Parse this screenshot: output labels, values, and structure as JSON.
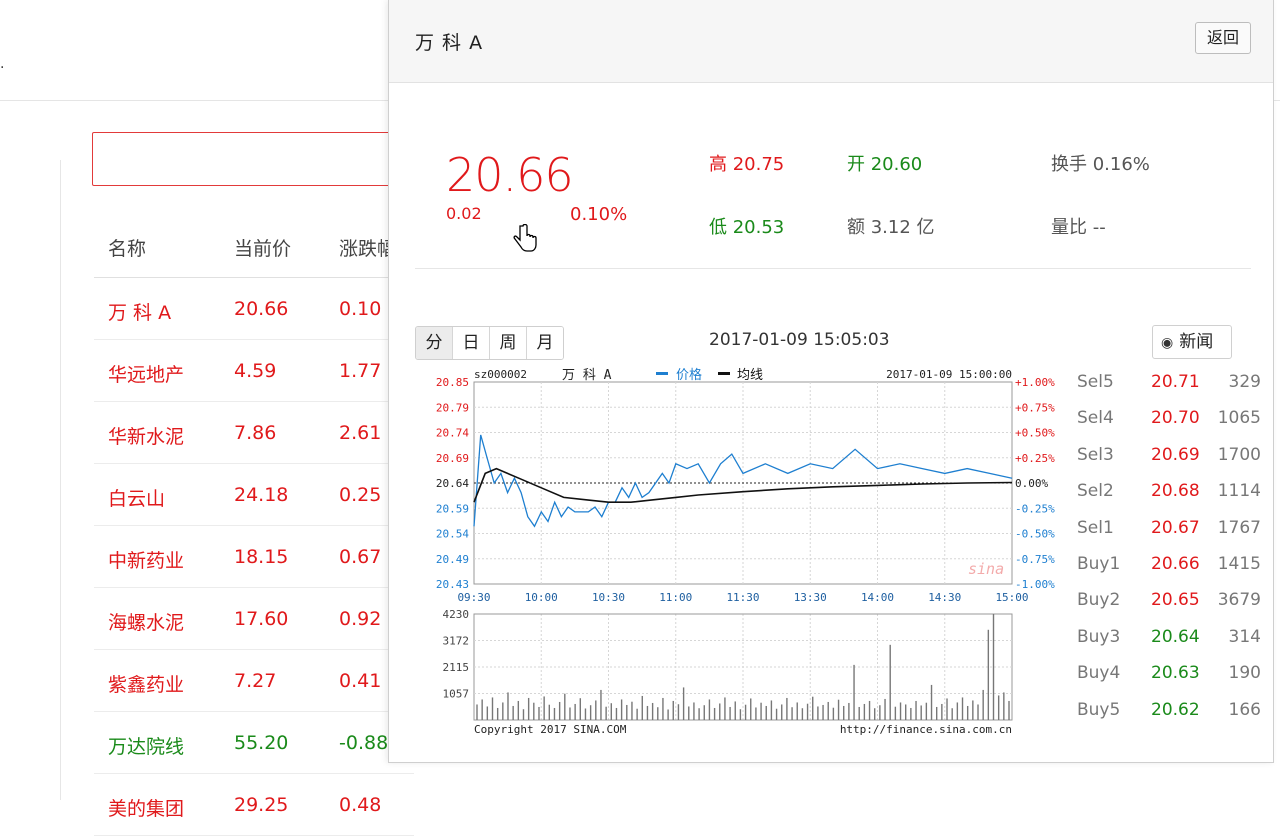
{
  "background": {
    "table_headers": [
      "名称",
      "当前价",
      "涨跌幅"
    ],
    "rows": [
      {
        "name": "万 科 A",
        "price": "20.66",
        "change": "0.10",
        "trend": "up"
      },
      {
        "name": "华远地产",
        "price": "4.59",
        "change": "1.77",
        "trend": "up"
      },
      {
        "name": "华新水泥",
        "price": "7.86",
        "change": "2.61",
        "trend": "up"
      },
      {
        "name": "白云山",
        "price": "24.18",
        "change": "0.25",
        "trend": "up"
      },
      {
        "name": "中新药业",
        "price": "18.15",
        "change": "0.67",
        "trend": "up"
      },
      {
        "name": "海螺水泥",
        "price": "17.60",
        "change": "0.92",
        "trend": "up"
      },
      {
        "name": "紫鑫药业",
        "price": "7.27",
        "change": "0.41",
        "trend": "up"
      },
      {
        "name": "万达院线",
        "price": "55.20",
        "change": "-0.88",
        "trend": "down"
      },
      {
        "name": "美的集团",
        "price": "29.25",
        "change": "0.48",
        "trend": "up"
      }
    ]
  },
  "panel": {
    "title": "万 科 A",
    "back_label": "返回",
    "price": "20.66",
    "change": "0.02",
    "change_pct": "0.10%",
    "high": "高 20.75",
    "low": "低 20.53",
    "open": "开 20.60",
    "amount": "额 3.12 亿",
    "turnover": "换手 0.16%",
    "volume_ratio": "量比 --",
    "tabs": [
      "分",
      "日",
      "周",
      "月"
    ],
    "active_tab": 0,
    "chart_time": "2017-01-09 15:05:03",
    "news_label": "新闻"
  },
  "order_book": [
    {
      "label": "Sel5",
      "price": "20.71",
      "volume": "329",
      "color": "#e0191b"
    },
    {
      "label": "Sel4",
      "price": "20.70",
      "volume": "1065",
      "color": "#e0191b"
    },
    {
      "label": "Sel3",
      "price": "20.69",
      "volume": "1700",
      "color": "#e0191b"
    },
    {
      "label": "Sel2",
      "price": "20.68",
      "volume": "1114",
      "color": "#e0191b"
    },
    {
      "label": "Sel1",
      "price": "20.67",
      "volume": "1767",
      "color": "#e0191b"
    },
    {
      "label": "Buy1",
      "price": "20.66",
      "volume": "1415",
      "color": "#e0191b"
    },
    {
      "label": "Buy2",
      "price": "20.65",
      "volume": "3679",
      "color": "#e0191b"
    },
    {
      "label": "Buy3",
      "price": "20.64",
      "volume": "314",
      "color": "#1a8a1a"
    },
    {
      "label": "Buy4",
      "price": "20.63",
      "volume": "190",
      "color": "#1a8a1a"
    },
    {
      "label": "Buy5",
      "price": "20.62",
      "volume": "166",
      "color": "#1a8a1a"
    }
  ],
  "chart_data": {
    "type": "line",
    "symbol": "sz000002",
    "name": "万 科 A",
    "timestamp": "2017-01-09 15:00:00",
    "legend": [
      "价格",
      "均线"
    ],
    "x_ticks": [
      "09:30",
      "10:00",
      "10:30",
      "11:00",
      "11:30",
      "13:30",
      "14:00",
      "14:30",
      "15:00"
    ],
    "y_ticks_left": [
      "20.85",
      "20.79",
      "20.74",
      "20.69",
      "20.64",
      "20.59",
      "20.54",
      "20.49",
      "20.43"
    ],
    "y_ticks_right": [
      "+1.00%",
      "+0.75%",
      "+0.50%",
      "+0.25%",
      "0.00%",
      "-0.25%",
      "-0.50%",
      "-0.75%",
      "-1.00%"
    ],
    "ylim": [
      20.43,
      20.85
    ],
    "prev_close": 20.64,
    "series": [
      {
        "name": "价格",
        "color": "#1e7fd0",
        "x": [
          0,
          3,
          6,
          9,
          12,
          15,
          18,
          21,
          24,
          27,
          30,
          33,
          36,
          39,
          42,
          45,
          48,
          51,
          54,
          57,
          60,
          63,
          66,
          69,
          72,
          75,
          78,
          81,
          84,
          87,
          90,
          95,
          100,
          105,
          110,
          115,
          120,
          130,
          140,
          150,
          160,
          170,
          180,
          190,
          200,
          210,
          220,
          230,
          240
        ],
        "y": [
          20.55,
          20.74,
          20.69,
          20.64,
          20.66,
          20.62,
          20.65,
          20.62,
          20.57,
          20.55,
          20.58,
          20.56,
          20.6,
          20.57,
          20.59,
          20.58,
          20.58,
          20.58,
          20.59,
          20.57,
          20.6,
          20.6,
          20.63,
          20.61,
          20.64,
          20.61,
          20.62,
          20.64,
          20.66,
          20.64,
          20.68,
          20.67,
          20.68,
          20.64,
          20.68,
          20.7,
          20.66,
          20.68,
          20.66,
          20.68,
          20.67,
          20.71,
          20.67,
          20.68,
          20.67,
          20.66,
          20.67,
          20.66,
          20.65
        ]
      },
      {
        "name": "均线",
        "color": "#111111",
        "x": [
          0,
          5,
          10,
          20,
          30,
          40,
          50,
          60,
          70,
          80,
          90,
          100,
          120,
          140,
          160,
          180,
          200,
          220,
          240
        ],
        "y": [
          20.6,
          20.66,
          20.67,
          20.65,
          20.63,
          20.61,
          20.605,
          20.6,
          20.6,
          20.605,
          20.61,
          20.615,
          20.622,
          20.628,
          20.632,
          20.635,
          20.638,
          20.64,
          20.641
        ]
      }
    ],
    "volume": {
      "y_ticks": [
        "4230",
        "3172",
        "2115",
        "1057"
      ],
      "ylim": [
        0,
        4230
      ],
      "bars": [
        620,
        820,
        540,
        900,
        480,
        700,
        1100,
        560,
        760,
        430,
        880,
        690,
        520,
        940,
        610,
        480,
        720,
        1050,
        500,
        640,
        870,
        460,
        590,
        780,
        1200,
        530,
        670,
        480,
        820,
        600,
        730,
        450,
        960,
        560,
        680,
        510,
        880,
        420,
        760,
        630,
        1300,
        540,
        700,
        470,
        590,
        820,
        480,
        660,
        900,
        520,
        740,
        430,
        610,
        860,
        500,
        690,
        560,
        780,
        450,
        620,
        880,
        510,
        700,
        470,
        650,
        930,
        540,
        600,
        720,
        490,
        810,
        560,
        680,
        2200,
        520,
        640,
        760,
        470,
        590,
        840,
        3000,
        530,
        700,
        620,
        480,
        760,
        580,
        690,
        1400,
        520,
        640,
        860,
        470,
        700,
        900,
        560,
        780,
        620,
        1200,
        3600,
        4230,
        980,
        1100,
        760
      ]
    },
    "footer_left": "Copyright 2017 SINA.COM",
    "footer_right": "http://finance.sina.com.cn",
    "watermark": "sina"
  }
}
